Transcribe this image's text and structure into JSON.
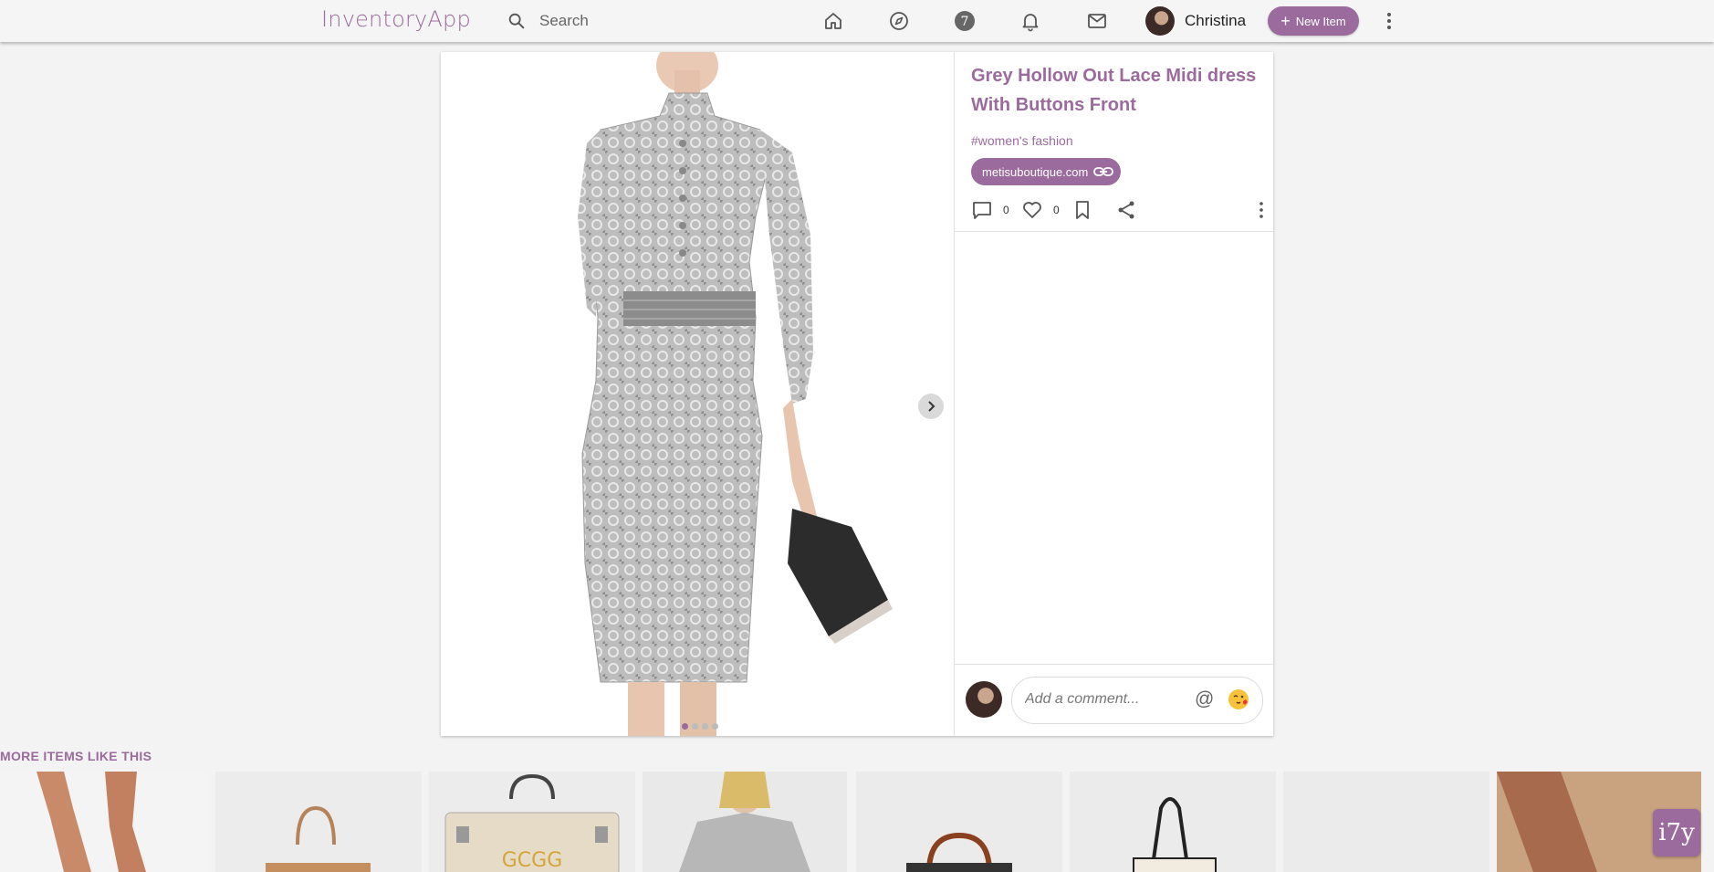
{
  "header": {
    "logo": "InventoryApp",
    "search_placeholder": "Search",
    "nav_icons": [
      "home-icon",
      "compass-icon",
      "brand-icon",
      "bell-icon",
      "mail-icon"
    ],
    "username": "Christina",
    "new_item_label": "New Item"
  },
  "item": {
    "title": "Grey Hollow Out Lace Midi dress With Buttons Front",
    "hashtag": "#women's fashion",
    "source_link": "metisuboutique.com",
    "comment_count": "0",
    "like_count": "0",
    "image_dots": 4,
    "active_dot": 0
  },
  "comment": {
    "placeholder": "Add a comment...",
    "mention_symbol": "@"
  },
  "more_items": {
    "label": "MORE ITEMS LIKE THIS",
    "thumbnails": [
      "legs",
      "tan-tote-bag",
      "cream-handbag",
      "grey-sweater-woman",
      "black-brown-satchel",
      "black-white-tote",
      "blank",
      "legs-tan"
    ]
  },
  "badge": {
    "text": "i7y"
  },
  "colors": {
    "accent": "#9a6b9c",
    "background": "#f3f3f3"
  }
}
